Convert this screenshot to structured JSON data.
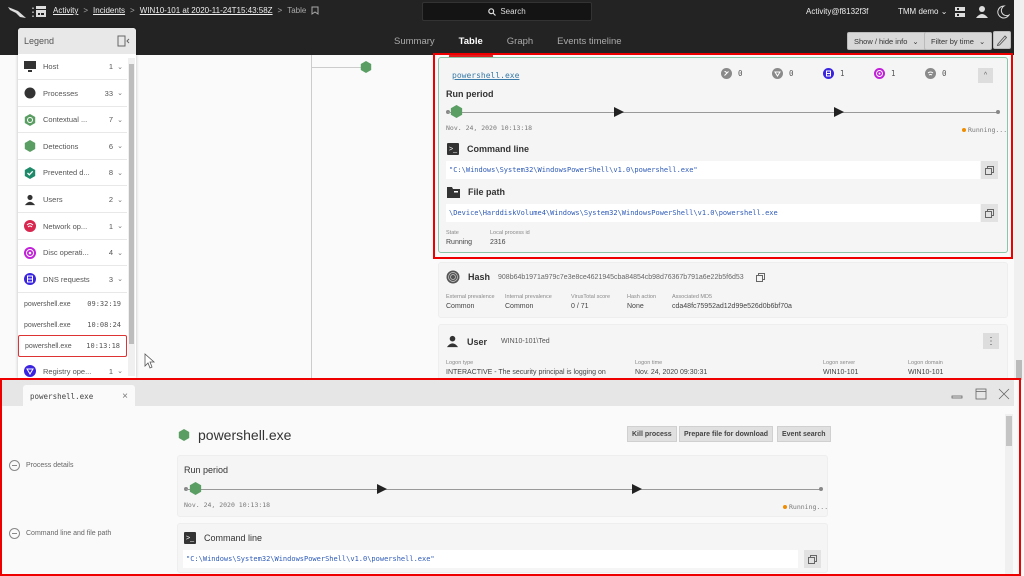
{
  "topbar": {
    "logo_icon": "falcon-logo-icon",
    "breadcrumb": [
      {
        "label": "Activity"
      },
      {
        "label": "Incidents"
      },
      {
        "label": "WIN10-101 at 2020-11-24T15:43:58Z"
      }
    ],
    "breadcrumb_current": "Table",
    "search_label": "Search",
    "account": "Activity@f8132f3f",
    "tenant": "TMM demo",
    "tenant_caret": "⌄"
  },
  "tabs": [
    {
      "label": "Summary",
      "active": false
    },
    {
      "label": "Table",
      "active": true
    },
    {
      "label": "Graph",
      "active": false
    },
    {
      "label": "Events timeline",
      "active": false
    }
  ],
  "toolbar": {
    "show_hide_label": "Show / hide info",
    "filter_label": "Filter by time",
    "caret": "⌄"
  },
  "legend": {
    "title": "Legend",
    "items": [
      {
        "label": "Host",
        "count": "1",
        "icon": "host-icon"
      },
      {
        "label": "Processes",
        "count": "33",
        "icon": "process-icon"
      },
      {
        "label": "Contextual ...",
        "count": "7",
        "icon": "contextual-icon"
      },
      {
        "label": "Detections",
        "count": "6",
        "icon": "detection-icon"
      },
      {
        "label": "Prevented d...",
        "count": "8",
        "icon": "prevented-icon"
      },
      {
        "label": "Users",
        "count": "2",
        "icon": "user-icon"
      },
      {
        "label": "Network op...",
        "count": "1",
        "icon": "network-icon"
      },
      {
        "label": "Disc operati...",
        "count": "4",
        "icon": "disc-icon"
      },
      {
        "label": "DNS requests",
        "count": "3",
        "icon": "dns-icon"
      }
    ],
    "processes": [
      {
        "name": "powershell.exe",
        "time": "09:32:19",
        "selected": false
      },
      {
        "name": "powershell.exe",
        "time": "10:08:24",
        "selected": false
      },
      {
        "name": "powershell.exe",
        "time": "10:13:18",
        "selected": true
      }
    ],
    "last_item": {
      "label": "Registry ope...",
      "count": "1",
      "icon": "registry-icon"
    },
    "chevron": "⌄"
  },
  "process_card": {
    "name": "powershell.exe",
    "stats": [
      {
        "icon": "network-icon",
        "value": "0",
        "color": "#8a8a8a"
      },
      {
        "icon": "registry-icon",
        "value": "0",
        "color": "#8a8a8a"
      },
      {
        "icon": "dns-icon",
        "value": "1",
        "color": "#3a24e0"
      },
      {
        "icon": "disc-icon",
        "value": "1",
        "color": "#c020d8"
      },
      {
        "icon": "network-op-icon",
        "value": "0",
        "color": "#8a8a8a"
      }
    ],
    "collapse_glyph": "^",
    "run_period_title": "Run period",
    "start_time": "Nov. 24, 2020 10:13:18",
    "status_running": "Running...",
    "command_line_title": "Command line",
    "command_line": "\"C:\\Windows\\System32\\WindowsPowerShell\\v1.0\\powershell.exe\"",
    "file_path_title": "File path",
    "file_path": "\\Device\\HarddiskVolume4\\Windows\\System32\\WindowsPowerShell\\v1.0\\powershell.exe",
    "state_label": "State",
    "state_value": "Running",
    "pid_label": "Local process id",
    "pid_value": "2316"
  },
  "hash_card": {
    "title": "Hash",
    "sha256": "908b64b1971a979c7e3e8ce4621945cba84854cb98d76367b791a6e22b5f6d53",
    "fields": [
      {
        "label": "External prevalence",
        "value": "Common"
      },
      {
        "label": "Internal prevalence",
        "value": "Common"
      },
      {
        "label": "VirusTotal score",
        "value": "0 / 71"
      },
      {
        "label": "Hash action",
        "value": "None"
      },
      {
        "label": "Associated MD5",
        "value": "cda48fc75952ad12d99e526d0b6bf70a"
      }
    ]
  },
  "user_card": {
    "title": "User",
    "value": "WIN10-101\\Ted",
    "menu_glyph": "⋮",
    "fields": [
      {
        "label": "Logon type",
        "value": "INTERACTIVE - The security principal is logging on"
      },
      {
        "label": "Logon time",
        "value": "Nov. 24, 2020 09:30:31"
      },
      {
        "label": "Logon server",
        "value": "WIN10-101"
      },
      {
        "label": "Logon domain",
        "value": "WIN10-101"
      }
    ]
  },
  "panel": {
    "tab_label": "powershell.exe",
    "tab_close": "×",
    "title": "powershell.exe",
    "nav": [
      {
        "label": "Process details"
      },
      {
        "label": "Command line and file path"
      }
    ],
    "actions": [
      {
        "label": "Kill process"
      },
      {
        "label": "Prepare file for download"
      },
      {
        "label": "Event search"
      }
    ],
    "run_period_title": "Run period",
    "start_time": "Nov. 24, 2020 10:13:18",
    "status_running": "Running...",
    "command_line_title": "Command line",
    "command_line": "\"C:\\Windows\\System32\\WindowsPowerShell\\v1.0\\powershell.exe\""
  },
  "colors": {
    "accent_red": "#e02020",
    "process_green": "#5a9e63",
    "running_orange": "#f08c00",
    "link_blue": "#2e5bb8"
  }
}
